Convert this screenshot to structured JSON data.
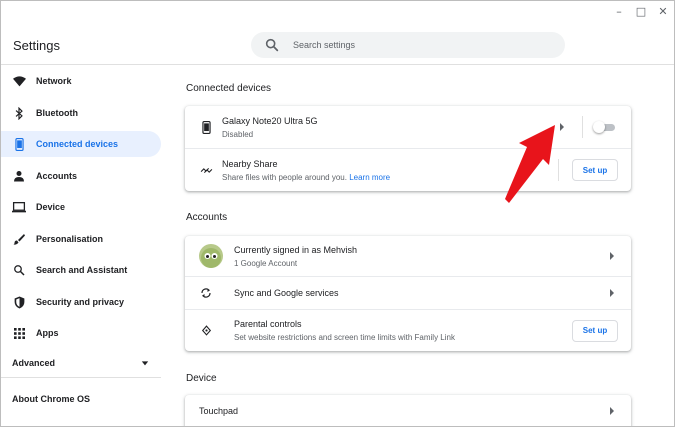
{
  "window": {
    "controls": {
      "minimize": "–",
      "maximize": "□",
      "close": "✕"
    }
  },
  "header": {
    "title": "Settings",
    "search": {
      "placeholder": "Search settings",
      "icon": "search-icon"
    }
  },
  "sidebar": {
    "items": [
      {
        "label": "Network",
        "icon": "wifi-icon",
        "active": false
      },
      {
        "label": "Bluetooth",
        "icon": "bluetooth-icon",
        "active": false
      },
      {
        "label": "Connected devices",
        "icon": "phone-icon",
        "active": true
      },
      {
        "label": "Accounts",
        "icon": "person-icon",
        "active": false
      },
      {
        "label": "Device",
        "icon": "laptop-icon",
        "active": false
      },
      {
        "label": "Personalisation",
        "icon": "brush-icon",
        "active": false
      },
      {
        "label": "Search and Assistant",
        "icon": "search-icon",
        "active": false
      },
      {
        "label": "Security and privacy",
        "icon": "shield-icon",
        "active": false
      },
      {
        "label": "Apps",
        "icon": "grid-icon",
        "active": false
      }
    ],
    "advanced_label": "Advanced",
    "about_label": "About Chrome OS"
  },
  "main": {
    "connected_devices": {
      "title": "Connected devices",
      "phone": {
        "name": "Galaxy Note20 Ultra 5G",
        "status": "Disabled",
        "enabled": false
      },
      "nearby_share": {
        "title": "Nearby Share",
        "description": "Share files with people around you.",
        "link": "Learn more",
        "button": "Set up"
      }
    },
    "accounts": {
      "title": "Accounts",
      "current": {
        "title": "Currently signed in as Mehvish",
        "subtitle": "1 Google Account"
      },
      "sync": {
        "title": "Sync and Google services"
      },
      "parental": {
        "title": "Parental controls",
        "description": "Set website restrictions and screen time limits with Family Link",
        "button": "Set up"
      }
    },
    "device": {
      "title": "Device",
      "touchpad": {
        "title": "Touchpad"
      }
    }
  },
  "colors": {
    "accent": "#1a73e8",
    "active_bg": "#e8f0fe",
    "annotation_arrow": "#e8141b"
  }
}
